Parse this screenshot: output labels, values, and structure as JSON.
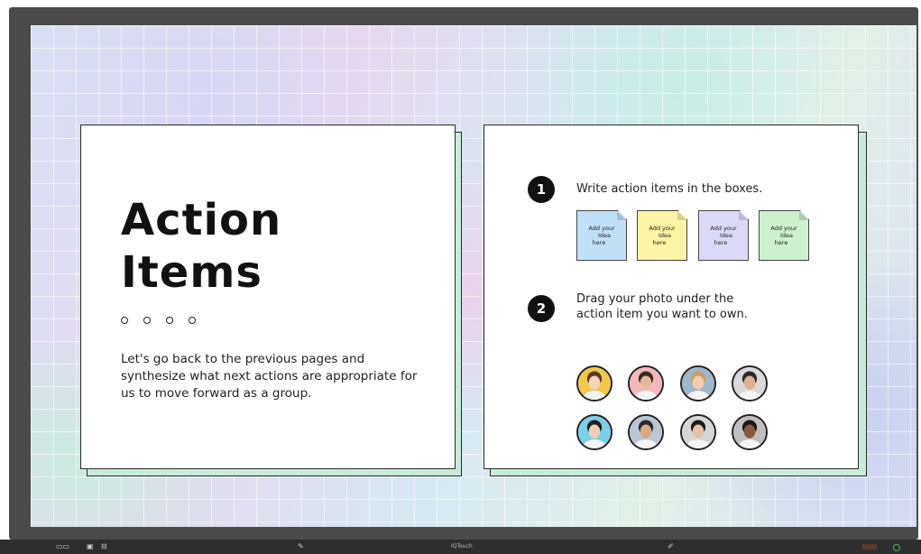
{
  "slide": {
    "title_line1": "Action",
    "title_line2": "Items",
    "description": "Let's go back to the previous pages and synthesize what next actions are appropriate for us to move forward as a group.",
    "step1": {
      "number": "1",
      "text": "Write action items in the boxes."
    },
    "step2": {
      "number": "2",
      "text_line1": "Drag your photo under the",
      "text_line2": "action item you want to own."
    },
    "stickies": [
      {
        "line1": "Add your",
        "line2": "Idea here",
        "color": "#bfe0f7"
      },
      {
        "line1": "Add your",
        "line2": "Idea here",
        "color": "#fbf4a4"
      },
      {
        "line1": "Add your",
        "line2": "Idea here",
        "color": "#dcd9f8"
      },
      {
        "line1": "Add your",
        "line2": "Idea here",
        "color": "#cdf0cf"
      }
    ],
    "avatar_backgrounds": [
      "#f1c84b",
      "#f3b7bd",
      "#9fb6c8",
      "#d9d9d9",
      "#7ad0e6",
      "#b9c7d4",
      "#d6d6d6",
      "#bfbfbf"
    ]
  },
  "taskbar": {
    "label": "IQTouch"
  },
  "colors": {
    "card_shadow": "#c7ecd9",
    "badge": "#111111",
    "bezel": "#4a4a4a"
  }
}
